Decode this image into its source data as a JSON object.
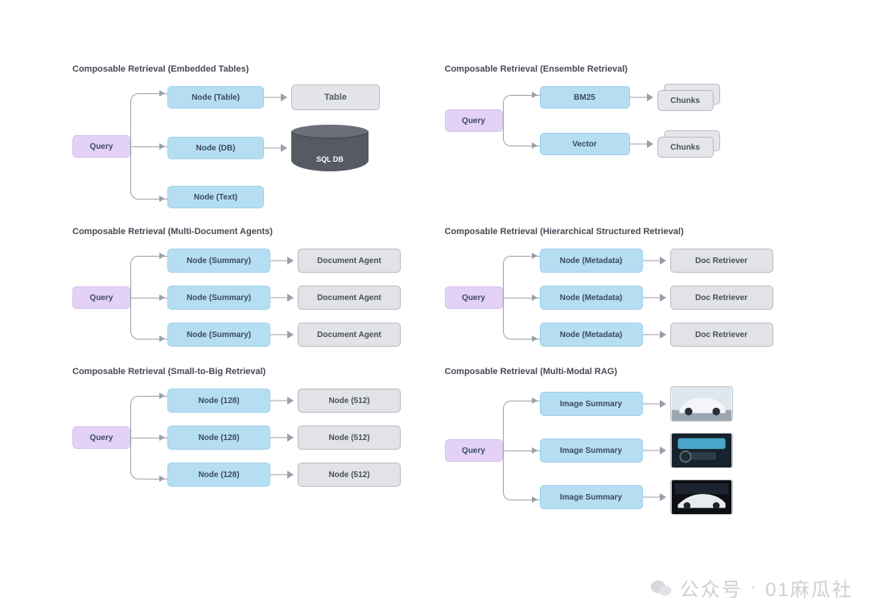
{
  "panels": [
    {
      "title": "Composable Retrieval (Embedded Tables)",
      "query": "Query",
      "children": [
        {
          "node": "Node (Table)",
          "out": {
            "type": "table",
            "label": "Table"
          }
        },
        {
          "node": "Node (DB)",
          "out": {
            "type": "db",
            "label": "SQL DB"
          }
        },
        {
          "node": "Node (Text)"
        }
      ]
    },
    {
      "title": "Composable Retrieval (Ensemble Retrieval)",
      "query": "Query",
      "children": [
        {
          "node": "BM25",
          "out": {
            "type": "chunks",
            "label": "Chunks"
          }
        },
        {
          "node": "Vector",
          "out": {
            "type": "chunks",
            "label": "Chunks"
          }
        }
      ]
    },
    {
      "title": "Composable Retrieval (Multi-Document Agents)",
      "query": "Query",
      "children": [
        {
          "node": "Node (Summary)",
          "out": {
            "type": "grey",
            "label": "Document Agent"
          }
        },
        {
          "node": "Node (Summary)",
          "out": {
            "type": "grey",
            "label": "Document Agent"
          }
        },
        {
          "node": "Node (Summary)",
          "out": {
            "type": "grey",
            "label": "Document Agent"
          }
        }
      ]
    },
    {
      "title": "Composable Retrieval (Hierarchical Structured Retrieval)",
      "query": "Query",
      "children": [
        {
          "node": "Node (Metadata)",
          "out": {
            "type": "grey",
            "label": "Doc Retriever"
          }
        },
        {
          "node": "Node (Metadata)",
          "out": {
            "type": "grey",
            "label": "Doc Retriever"
          }
        },
        {
          "node": "Node (Metadata)",
          "out": {
            "type": "grey",
            "label": "Doc Retriever"
          }
        }
      ]
    },
    {
      "title": "Composable Retrieval (Small-to-Big Retrieval)",
      "query": "Query",
      "children": [
        {
          "node": "Node (128)",
          "out": {
            "type": "grey",
            "label": "Node (512)"
          }
        },
        {
          "node": "Node (128)",
          "out": {
            "type": "grey",
            "label": "Node (512)"
          }
        },
        {
          "node": "Node (128)",
          "out": {
            "type": "grey",
            "label": "Node (512)"
          }
        }
      ]
    },
    {
      "title": "Composable Retrieval (Multi-Modal RAG)",
      "query": "Query",
      "children": [
        {
          "node": "Image Summary",
          "out": {
            "type": "image",
            "variant": "car-exterior-white"
          }
        },
        {
          "node": "Image Summary",
          "out": {
            "type": "image",
            "variant": "car-interior"
          }
        },
        {
          "node": "Image Summary",
          "out": {
            "type": "image",
            "variant": "car-showroom"
          }
        }
      ]
    }
  ],
  "watermark": {
    "prefix": "公众号",
    "sep": "·",
    "name": "01麻瓜社"
  }
}
